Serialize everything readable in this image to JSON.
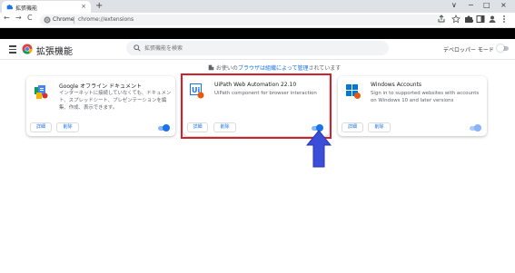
{
  "browser": {
    "tab_title": "拡張機能",
    "tab_close": "×",
    "new_tab": "+",
    "window_controls": [
      "∨",
      "−",
      "□",
      "×"
    ],
    "nav": {
      "back": "←",
      "forward": "→",
      "reload": "C"
    },
    "omnibox_label": "Chrome",
    "url": "chrome://extensions"
  },
  "header": {
    "title": "拡張機能",
    "search_placeholder": "拡張機能を検索",
    "dev_mode_label": "デベロッパー モード",
    "dev_mode_enabled": false
  },
  "managed_notice": {
    "prefix": "お使いの",
    "link": "ブラウザは組織によって管理",
    "suffix": "されています"
  },
  "extensions": [
    {
      "name": "Google オフライン ドキュメント",
      "description": "インターネットに接続していなくても、ドキュメント、スプレッドシート、プレゼンテーションを編集、作成、表示できます。",
      "details_label": "詳細",
      "remove_label": "削除",
      "enabled": true
    },
    {
      "name": "UiPath Web Automation 22.10",
      "description": "UiPath component for browser interaction",
      "details_label": "詳細",
      "remove_label": "削除",
      "enabled": true
    },
    {
      "name": "Windows Accounts",
      "description": "Sign in to supported websites with accounts on Windows 10 and later versions",
      "details_label": "詳細",
      "remove_label": "削除",
      "enabled": true
    }
  ],
  "colors": {
    "accent": "#1a73e8",
    "highlight_box": "#d0212e",
    "arrow": "#3b4ed8"
  }
}
